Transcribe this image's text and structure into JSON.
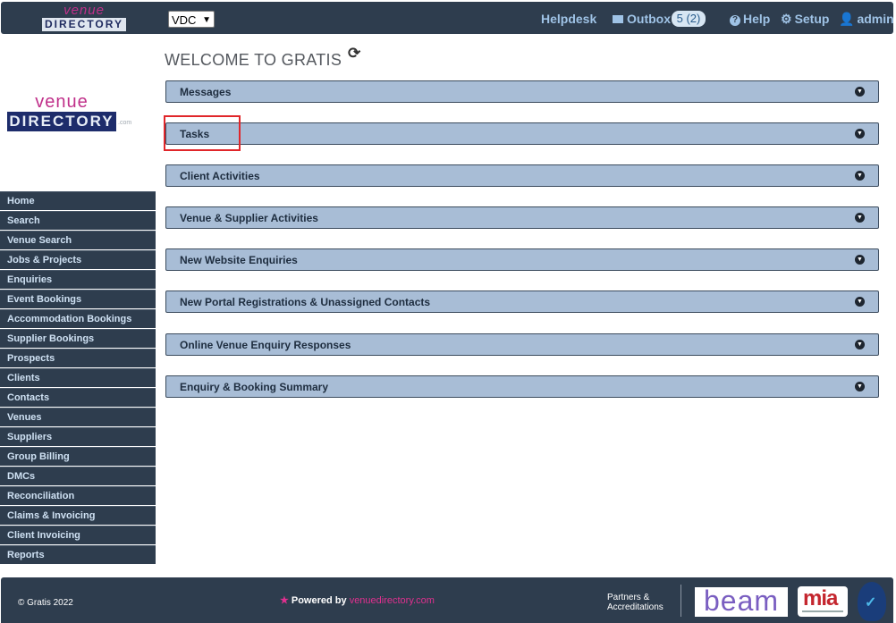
{
  "header": {
    "logo_top": "venue",
    "logo_bottom": "DIRECTORY",
    "company_select": "VDC",
    "helpdesk": "Helpdesk",
    "outbox": "Outbox",
    "outbox_badge": "5 (2)",
    "help": "Help",
    "setup": "Setup",
    "user": "admin"
  },
  "left_logo": {
    "top": "venue",
    "bottom": "DIRECTORY",
    "suffix": ".com"
  },
  "sidebar": {
    "items": [
      {
        "label": "Home"
      },
      {
        "label": "Search"
      },
      {
        "label": "Venue Search"
      },
      {
        "label": "Jobs & Projects"
      },
      {
        "label": "Enquiries"
      },
      {
        "label": "Event Bookings"
      },
      {
        "label": "Accommodation Bookings"
      },
      {
        "label": "Supplier Bookings"
      },
      {
        "label": "Prospects"
      },
      {
        "label": "Clients"
      },
      {
        "label": "Contacts"
      },
      {
        "label": "Venues"
      },
      {
        "label": "Suppliers"
      },
      {
        "label": "Group Billing"
      },
      {
        "label": "DMCs"
      },
      {
        "label": "Reconciliation"
      },
      {
        "label": "Claims & Invoicing"
      },
      {
        "label": "Client Invoicing"
      },
      {
        "label": "Reports"
      }
    ]
  },
  "main": {
    "title": "WELCOME TO GRATIS",
    "panels": [
      {
        "title": "Messages"
      },
      {
        "title": "Tasks"
      },
      {
        "title": "Client Activities"
      },
      {
        "title": "Venue & Supplier Activities"
      },
      {
        "title": "New Website Enquiries"
      },
      {
        "title": "New Portal Registrations & Unassigned Contacts"
      },
      {
        "title": "Online Venue Enquiry Responses"
      },
      {
        "title": "Enquiry & Booking Summary"
      }
    ]
  },
  "footer": {
    "copyright": "© Gratis 2022",
    "powered_by": "Powered by",
    "powered_brand": "venuedirectory.com",
    "partners_line1": "Partners &",
    "partners_line2": "Accreditations",
    "beam": "beam",
    "mia": "mia"
  },
  "colors": {
    "navbar": "#2e3d4e",
    "panel": "#a8bdd6",
    "accent_pink": "#e0308f",
    "highlight": "#e0262a"
  }
}
